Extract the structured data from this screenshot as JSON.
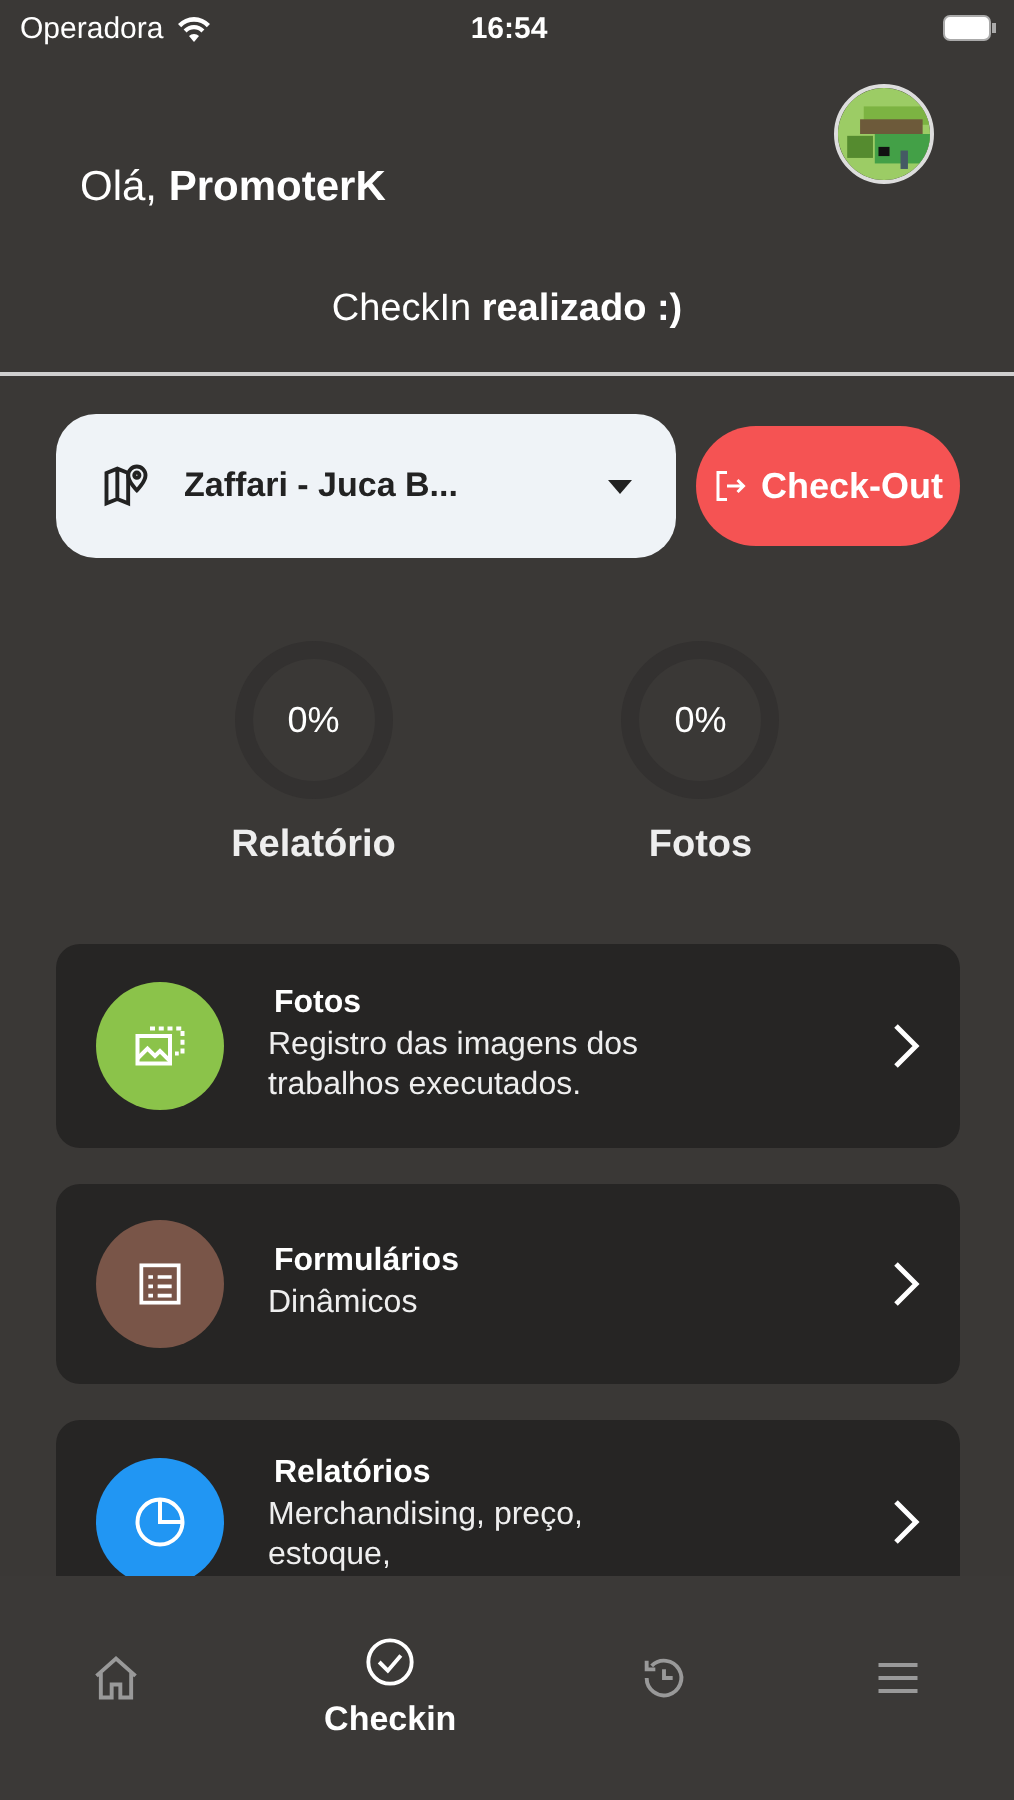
{
  "status_bar": {
    "carrier": "Operadora",
    "time": "16:54"
  },
  "header": {
    "greeting": "Olá, **PromoterK**"
  },
  "checkin_status": "CheckIn **realizado :)**",
  "store_select": {
    "value": "Zaffari - Juca B..."
  },
  "checkout_button": "Check-Out",
  "progress": [
    {
      "label": "Relatório",
      "reading": "0%"
    },
    {
      "label": "Fotos",
      "reading": "0%"
    }
  ],
  "menu": [
    {
      "kind": "photos",
      "title": "Fotos",
      "subtitle": "Registro das imagens dos trabalhos executados.",
      "color": "#8bc34a"
    },
    {
      "kind": "forms",
      "title": "Formulários",
      "subtitle": "Dinâmicos",
      "color": "#795548"
    },
    {
      "kind": "reports",
      "title": "Relatórios",
      "subtitle": "Merchandising, preço, estoque,",
      "color": "#2196f3"
    }
  ],
  "nav": [
    {
      "kind": "home",
      "selected": false
    },
    {
      "kind": "checkin",
      "label": "Checkin",
      "selected": true
    },
    {
      "kind": "history",
      "selected": false
    },
    {
      "kind": "menu",
      "selected": false
    }
  ]
}
